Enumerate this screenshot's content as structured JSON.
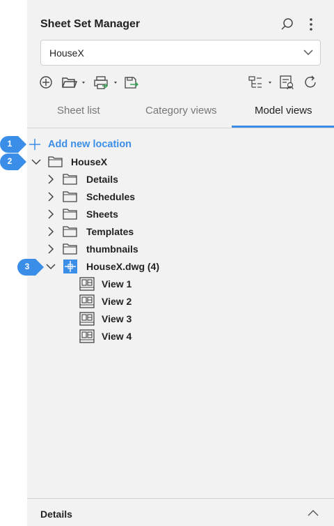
{
  "header": {
    "title": "Sheet Set Manager"
  },
  "selector": {
    "value": "HouseX"
  },
  "tabs": [
    {
      "label": "Sheet list"
    },
    {
      "label": "Category views"
    },
    {
      "label": "Model views"
    }
  ],
  "tree": {
    "add_label": "Add new location",
    "root": "HouseX",
    "folders": [
      "Details",
      "Schedules",
      "Sheets",
      "Templates",
      "thumbnails"
    ],
    "drawing": "HouseX.dwg (4)",
    "views": [
      "View 1",
      "View 2",
      "View 3",
      "View 4"
    ]
  },
  "callouts": [
    "1",
    "2",
    "3"
  ],
  "footer": {
    "details_label": "Details"
  },
  "colors": {
    "accent": "#3b8ee8",
    "panel": "#f2f2f2"
  }
}
